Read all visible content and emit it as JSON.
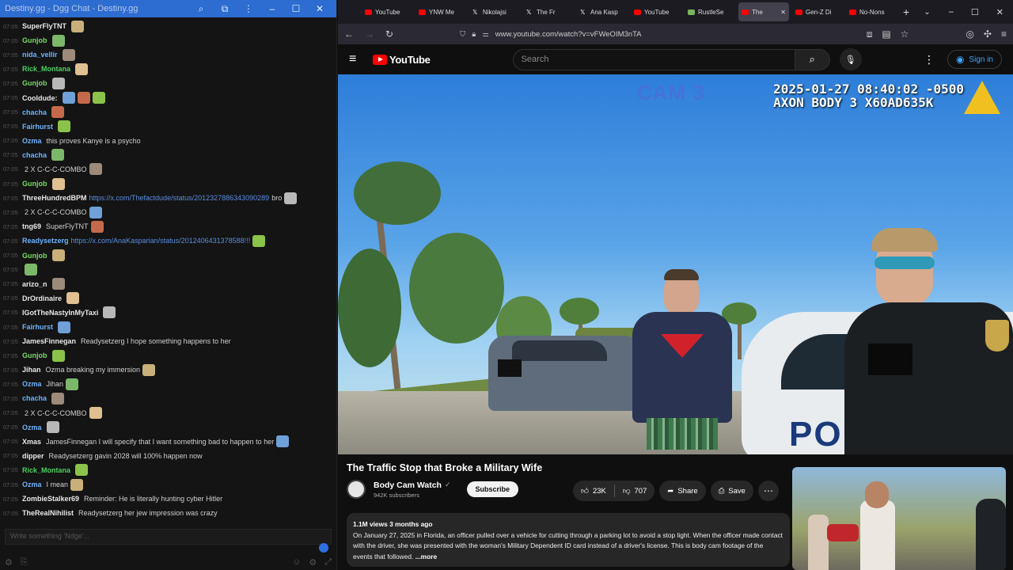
{
  "chat": {
    "title": "Destiny.gg - Dgg Chat - Destiny.gg",
    "input_placeholder": "Write something 'Ndge'...",
    "messages": [
      {
        "ts": "07:05",
        "user": "SuperFlyTNT",
        "color": "#e8e8e8",
        "text": "",
        "link": "",
        "emotes": 1
      },
      {
        "ts": "07:05",
        "user": "Gunjob",
        "color": "#7bd86a",
        "text": "",
        "link": "",
        "emotes": 1
      },
      {
        "ts": "07:05",
        "user": "nida_vellir",
        "color": "#6db3ff",
        "text": "",
        "link": "",
        "emotes": 1
      },
      {
        "ts": "07:05",
        "user": "Rick_Montana",
        "color": "#4fcf60",
        "text": "",
        "link": "",
        "emotes": 1
      },
      {
        "ts": "07:05",
        "user": "Gunjob",
        "color": "#7bd86a",
        "text": "",
        "link": "",
        "emotes": 1
      },
      {
        "ts": "07:05",
        "user": "Cooldude:",
        "color": "#e8e8e8",
        "text": "",
        "link": "",
        "emotes": 3
      },
      {
        "ts": "07:05",
        "user": "chacha",
        "color": "#6db3ff",
        "text": "",
        "link": "",
        "emotes": 1
      },
      {
        "ts": "07:05",
        "user": "Fairhurst",
        "color": "#6db3ff",
        "text": "",
        "link": "",
        "emotes": 1
      },
      {
        "ts": "07:05",
        "user": "Ozma",
        "color": "#6db3ff",
        "text": "this proves Kanye is a psycho",
        "link": "",
        "emotes": 0
      },
      {
        "ts": "07:05",
        "user": "chacha",
        "color": "#6db3ff",
        "text": "",
        "link": "",
        "emotes": 1
      },
      {
        "ts": "07:05",
        "user": "",
        "color": "#d0d0d0",
        "text": "2 X C-C-C-COMBO",
        "link": "",
        "emotes": 1
      },
      {
        "ts": "07:05",
        "user": "Gunjob",
        "color": "#7bd86a",
        "text": "",
        "link": "",
        "emotes": 1
      },
      {
        "ts": "07:05",
        "user": "ThreeHundredBPM",
        "color": "#e8e8e8",
        "text": "bro",
        "link": "https://x.com/Thefactdude/status/2012327886343090289",
        "emotes": 1
      },
      {
        "ts": "07:05",
        "user": "",
        "color": "#d0d0d0",
        "text": "2 X C-C-C-COMBO",
        "link": "",
        "emotes": 1
      },
      {
        "ts": "07:05",
        "user": "tng69",
        "color": "#e8e8e8",
        "text": "SuperFlyTNT",
        "link": "",
        "emotes": 1
      },
      {
        "ts": "07:05",
        "user": "Readysetzerg",
        "color": "#6db3ff",
        "text": "",
        "link": "https://x.com/AnaKasparian/status/2012406431378588!!!",
        "emotes": 1
      },
      {
        "ts": "07:05",
        "user": "Gunjob",
        "color": "#7bd86a",
        "text": "",
        "link": "",
        "emotes": 1
      },
      {
        "ts": "07:05",
        "user": "",
        "color": "#d0d0d0",
        "text": "",
        "link": "",
        "emotes": 1
      },
      {
        "ts": "07:05",
        "user": "arizo_n",
        "color": "#e8e8e8",
        "text": "",
        "link": "",
        "emotes": 1
      },
      {
        "ts": "07:05",
        "user": "DrOrdinaire",
        "color": "#e8e8e8",
        "text": "",
        "link": "",
        "emotes": 1
      },
      {
        "ts": "07:05",
        "user": "IGotTheNastyInMyTaxi",
        "color": "#e8e8e8",
        "text": "",
        "link": "",
        "emotes": 1
      },
      {
        "ts": "07:05",
        "user": "Fairhurst",
        "color": "#6db3ff",
        "text": "",
        "link": "",
        "emotes": 1
      },
      {
        "ts": "07:05",
        "user": "JamesFinnegan",
        "color": "#e8e8e8",
        "text": "Readysetzerg I hope something happens to her",
        "link": "",
        "emotes": 0
      },
      {
        "ts": "07:05",
        "user": "Gunjob",
        "color": "#7bd86a",
        "text": "",
        "link": "",
        "emotes": 1
      },
      {
        "ts": "07:05",
        "user": "Jihan",
        "color": "#e8e8e8",
        "text": "Ozma breaking my immersion",
        "link": "",
        "emotes": 1
      },
      {
        "ts": "07:05",
        "user": "Ozma",
        "color": "#6db3ff",
        "text": "Jihan",
        "link": "",
        "emotes": 1
      },
      {
        "ts": "07:05",
        "user": "chacha",
        "color": "#6db3ff",
        "text": "",
        "link": "",
        "emotes": 1
      },
      {
        "ts": "07:05",
        "user": "",
        "color": "#d0d0d0",
        "text": "2 X C-C-C-COMBO",
        "link": "",
        "emotes": 1
      },
      {
        "ts": "07:05",
        "user": "Ozma",
        "color": "#6db3ff",
        "text": "",
        "link": "",
        "emotes": 1
      },
      {
        "ts": "07:05",
        "user": "Xmas",
        "color": "#e8e8e8",
        "text": "JamesFinnegan I will specify that I want something bad to happen to her",
        "link": "",
        "emotes": 1
      },
      {
        "ts": "07:05",
        "user": "dipper",
        "color": "#e8e8e8",
        "text": "Readysetzerg gavin 2028 will 100% happen now",
        "link": "",
        "emotes": 0
      },
      {
        "ts": "07:05",
        "user": "Rick_Montana",
        "color": "#4fcf60",
        "text": "",
        "link": "",
        "emotes": 1
      },
      {
        "ts": "07:05",
        "user": "Ozma",
        "color": "#6db3ff",
        "text": "I mean",
        "link": "",
        "emotes": 1
      },
      {
        "ts": "07:05",
        "user": "ZombieStalker69",
        "color": "#e8e8e8",
        "text": "Reminder: He is literally hunting cyber Hitler",
        "link": "",
        "emotes": 0
      },
      {
        "ts": "07:05",
        "user": "TheRealNihilist",
        "color": "#e8e8e8",
        "text": "Readysetzerg her jew impression was crazy",
        "link": "",
        "emotes": 0
      }
    ]
  },
  "browser": {
    "tabs": [
      {
        "label": "YouTube",
        "icon": "youtube"
      },
      {
        "label": "YNW Me",
        "icon": "youtube"
      },
      {
        "label": "Nikolajsi",
        "icon": "x"
      },
      {
        "label": "The Fr",
        "icon": "x"
      },
      {
        "label": "Ana Kasp",
        "icon": "x"
      },
      {
        "label": "YouTube",
        "icon": "youtube"
      },
      {
        "label": "RustleSe",
        "icon": "green"
      },
      {
        "label": "The",
        "icon": "youtube",
        "active": true
      },
      {
        "label": "Gen-Z Di",
        "icon": "youtube"
      },
      {
        "label": "No-Nons",
        "icon": "youtube"
      }
    ],
    "url": "www.youtube.com/watch?v=vFWeOIM3nTA"
  },
  "youtube": {
    "logo_text": "YouTube",
    "search_placeholder": "Search",
    "signin_label": "Sign in",
    "video": {
      "cam_label": "CAM 3",
      "timestamp_line1": "2025-01-27 08:40:02 -0500",
      "timestamp_line2": "AXON BODY 3 X60AD635K",
      "cruiser_text": "PO"
    },
    "title": "The Traffic Stop that Broke a Military Wife",
    "channel": {
      "name": "Body Cam Watch",
      "subs": "942K subscribers"
    },
    "subscribe_label": "Subscribe",
    "likes": "23K",
    "dislikes": "707",
    "share_label": "Share",
    "save_label": "Save",
    "description": {
      "stats": "1.1M views  3 months ago",
      "text": "On January 27, 2025 in Florida, an officer pulled over a vehicle for cutting through a parking lot to avoid a stop light. When the officer made contact with the driver, she was presented with the woman's Military Dependent ID card instead of a driver's license. This is body cam footage of the events that followed.",
      "more": "...more"
    }
  }
}
